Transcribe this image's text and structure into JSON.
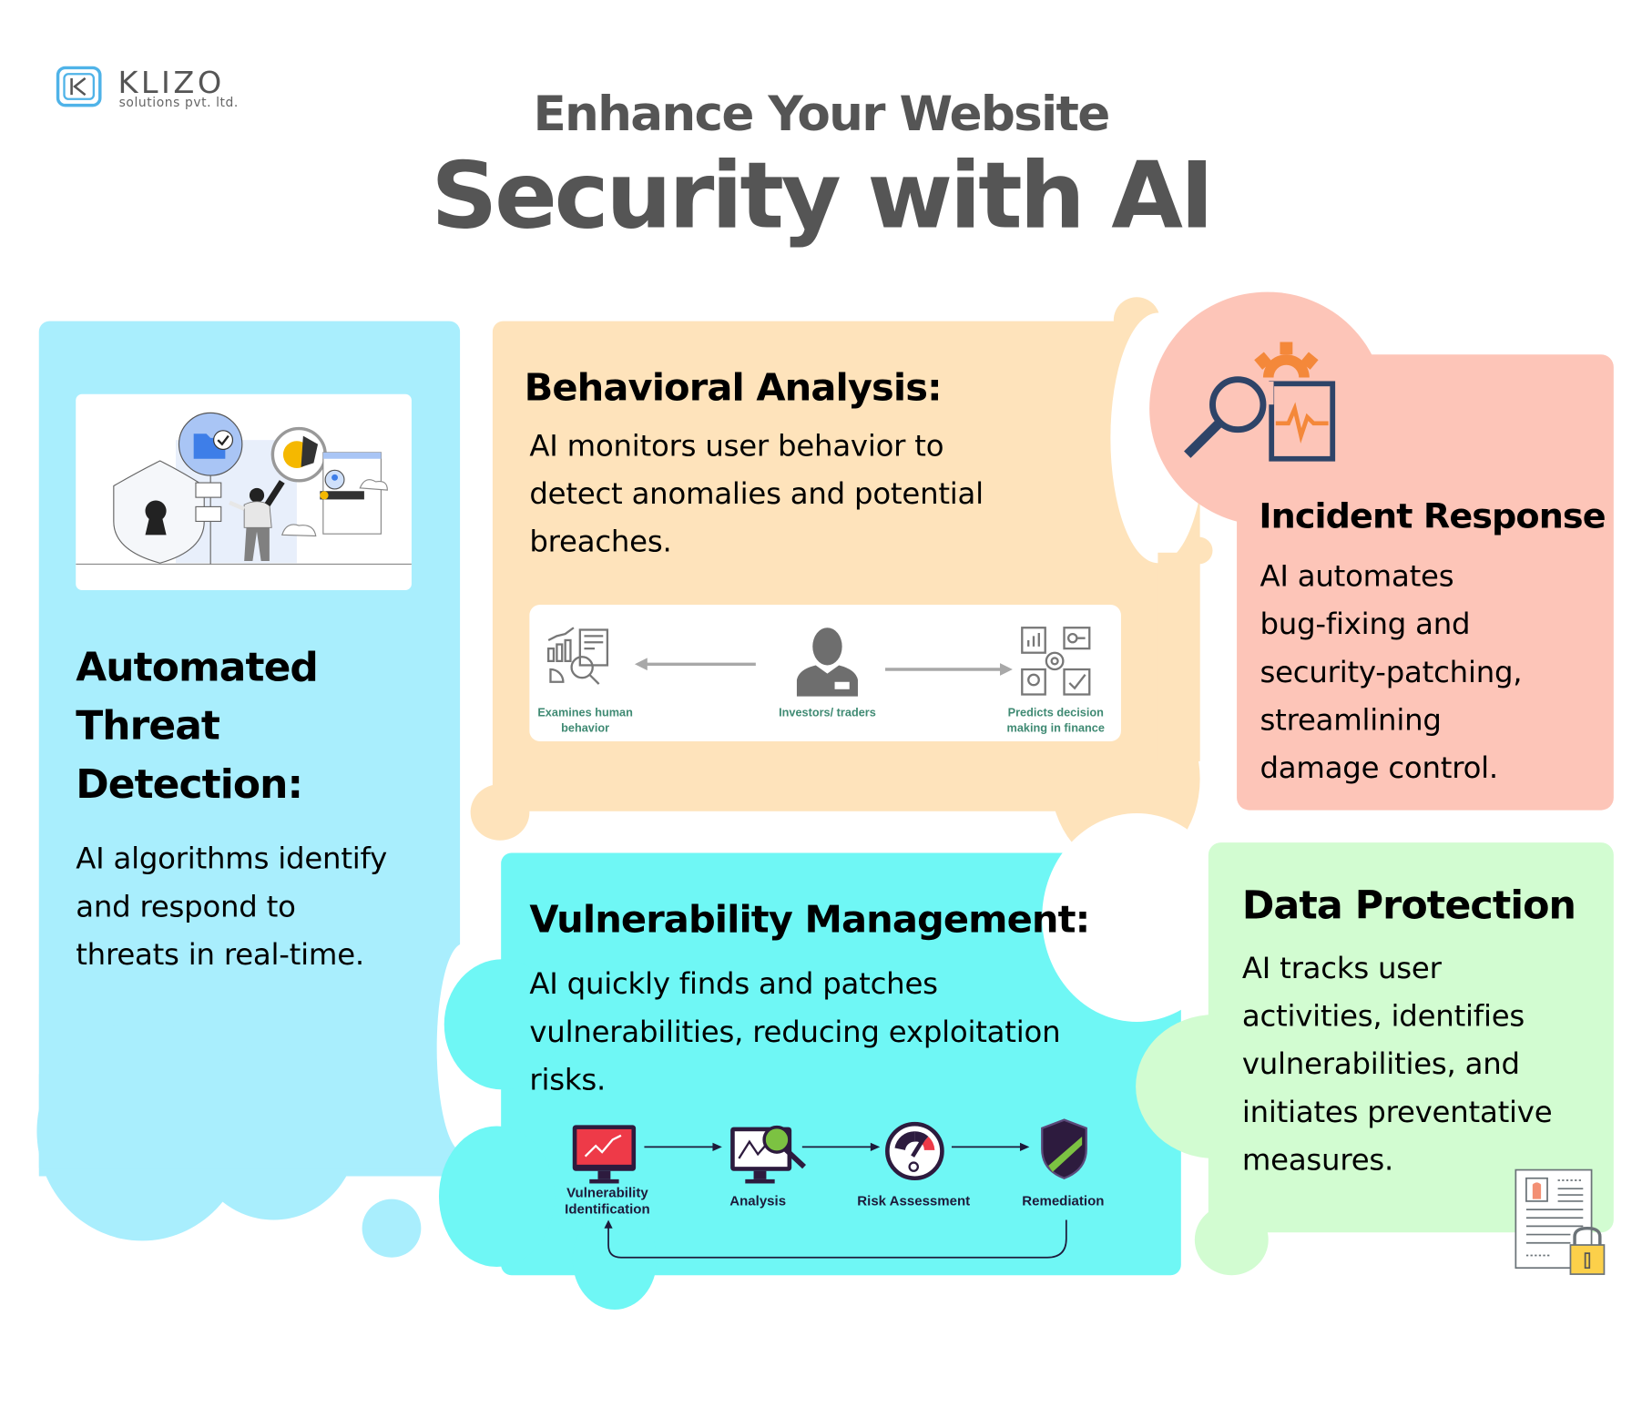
{
  "brand": {
    "name": "KLIZO",
    "tagline": "solutions pvt. ltd.",
    "logo_icon": "klizo-logo-icon"
  },
  "header": {
    "line1": "Enhance Your Website",
    "line2": "Security with AI"
  },
  "colors": {
    "threat_detection": "#a9eefd",
    "behavioral_analysis": "#fee3bb",
    "incident_response": "#fdc5b8",
    "vulnerability_management": "#6ff7f5",
    "data_protection": "#d2fcd1",
    "title_text": "#555555",
    "diagram_label": "#3f8a73"
  },
  "sections": {
    "threat_detection": {
      "title_lines": [
        "Automated",
        "Threat",
        "Detection:"
      ],
      "body_lines": [
        "AI algorithms identify",
        "and respond to",
        "threats in real-time."
      ],
      "illustration": "security-analyst-illustration"
    },
    "behavioral_analysis": {
      "title": "Behavioral Analysis:",
      "body_lines": [
        "AI monitors user behavior to",
        "detect anomalies and potential",
        "breaches."
      ],
      "diagram": {
        "left_label": [
          "Examines human",
          "behavior"
        ],
        "center_label": "Investors/ traders",
        "right_label": [
          "Predicts decision",
          "making in finance"
        ],
        "left_icon": "data-analysis-icon",
        "center_icon": "person-icon",
        "right_icon": "decision-dashboard-icon"
      }
    },
    "incident_response": {
      "title": "Incident Response",
      "body_lines": [
        "AI automates",
        "bug-fixing and",
        "security-patching,",
        "streamlining",
        "damage control."
      ],
      "icon": "incident-monitor-icon"
    },
    "vulnerability_management": {
      "title": "Vulnerability Management:",
      "body_lines": [
        "AI quickly finds and patches",
        "vulnerabilities, reducing exploitation",
        "risks."
      ],
      "flow": [
        {
          "label_lines": [
            "Vulnerability",
            "Identification"
          ],
          "icon": "monitor-chart-icon"
        },
        {
          "label_lines": [
            "Analysis"
          ],
          "icon": "monitor-magnifier-icon"
        },
        {
          "label_lines": [
            "Risk Assessment"
          ],
          "icon": "gauge-icon"
        },
        {
          "label_lines": [
            "Remediation"
          ],
          "icon": "shield-icon"
        }
      ]
    },
    "data_protection": {
      "title": "Data Protection",
      "body_lines": [
        "AI tracks user",
        "activities, identifies",
        "vulnerabilities, and",
        "initiates preventative",
        "measures."
      ],
      "icon": "locked-document-icon"
    }
  }
}
